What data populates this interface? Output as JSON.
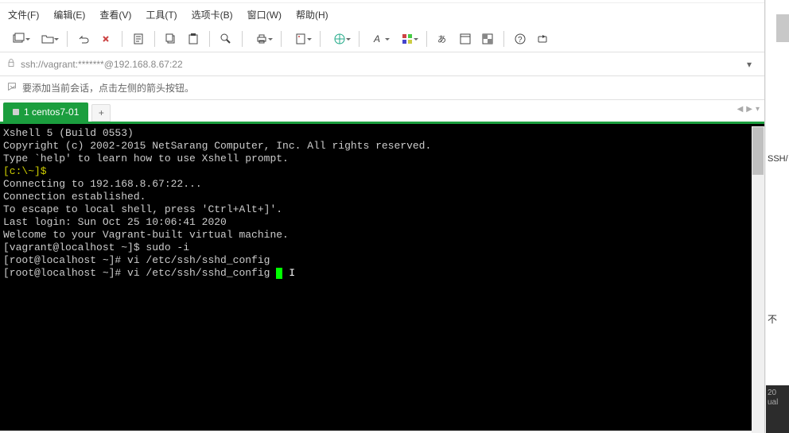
{
  "menu": {
    "file": "文件(F)",
    "edit": "编辑(E)",
    "view": "查看(V)",
    "tools": "工具(T)",
    "tabs": "选项卡(B)",
    "window": "窗口(W)",
    "help": "帮助(H)"
  },
  "addressbar": {
    "text": "ssh://vagrant:*******@192.168.8.67:22"
  },
  "infobar": {
    "text": "要添加当前会话，点击左侧的箭头按钮。"
  },
  "tabs": {
    "active": "1 centos7-01",
    "add": "+"
  },
  "terminal": {
    "lines": [
      "Xshell 5 (Build 0553)",
      "Copyright (c) 2002-2015 NetSarang Computer, Inc. All rights reserved.",
      "",
      "Type `help' to learn how to use Xshell prompt.",
      "[c:\\~]$",
      "",
      "Connecting to 192.168.8.67:22...",
      "Connection established.",
      "To escape to local shell, press 'Ctrl+Alt+]'.",
      "",
      "Last login: Sun Oct 25 10:06:41 2020",
      "Welcome to your Vagrant-built virtual machine.",
      "[vagrant@localhost ~]$ sudo -i",
      "[root@localhost ~]# vi /etc/ssh/sshd_config",
      "[root@localhost ~]# vi /etc/ssh/sshd_config "
    ],
    "prompt_line_index": 4
  },
  "side": {
    "text1": "SSH/",
    "text2": "不",
    "dark1": "20",
    "dark2": "ual"
  }
}
